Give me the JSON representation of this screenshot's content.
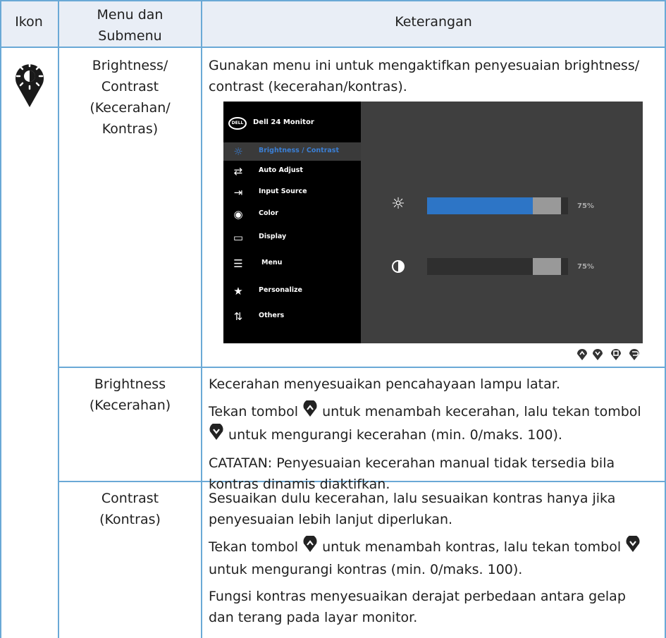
{
  "headers": {
    "icon": "Ikon",
    "menu_line1": "Menu dan",
    "menu_line2": "Submenu",
    "desc": "Keterangan"
  },
  "row1": {
    "icon_name": "brightness-icon",
    "menu": [
      "Brightness/",
      "Contrast",
      "(Kecerahan/",
      "Kontras)"
    ],
    "desc": [
      "Gunakan menu ini untuk mengaktifkan penyesuaian brightness/",
      "contrast (kecerahan/kontras)."
    ]
  },
  "osd": {
    "brand": "DELL",
    "title": "Dell 24 Monitor",
    "items": [
      {
        "label": "Brightness / Contrast",
        "icon": "sun-icon",
        "glyph": "☼",
        "selected": true
      },
      {
        "label": "Auto Adjust",
        "icon": "auto-adjust-icon",
        "glyph": "⇄",
        "selected": false
      },
      {
        "label": "Input Source",
        "icon": "input-source-icon",
        "glyph": "⇥",
        "selected": false
      },
      {
        "label": "Color",
        "icon": "color-palette-icon",
        "glyph": "◉",
        "selected": false
      },
      {
        "label": "Display",
        "icon": "display-icon",
        "glyph": "▭",
        "selected": false
      },
      {
        "label": "Menu",
        "icon": "menu-icon",
        "glyph": "☰",
        "selected": false
      },
      {
        "label": "Personalize",
        "icon": "star-icon",
        "glyph": "★",
        "selected": false
      },
      {
        "label": "Others",
        "icon": "others-icon",
        "glyph": "⇅",
        "selected": false
      }
    ],
    "brightness": {
      "level": 0.75,
      "label": "75%"
    },
    "contrast": {
      "level": 0.75,
      "label": "75%"
    }
  },
  "row2": {
    "menu": [
      "Brightness",
      "(Kecerahan)"
    ],
    "p1": "Kecerahan menyesuaikan pencahayaan lampu latar.",
    "p2a": "Tekan tombol",
    "p2b": "untuk menambah kecerahan, lalu tekan tombol",
    "p2c": "untuk mengurangi kecerahan (min. 0/maks. 100).",
    "note_label": "CATATAN:",
    "note_a": "Penyesuaian kecerahan manual tidak tersedia bila",
    "note_b": "kontras dinamis diaktifkan."
  },
  "row3": {
    "menu": [
      "Contrast",
      "(Kontras)"
    ],
    "p1a": "Sesuaikan dulu kecerahan, lalu sesuaikan kontras hanya jika",
    "p1b": "penyesuaian lebih lanjut diperlukan.",
    "p2a": "Tekan tombol",
    "p2b": "untuk menambah kontras, lalu tekan tombol",
    "p2c": "untuk mengurangi kontras (min. 0/maks. 100).",
    "p3a": "Fungsi kontras menyesuaikan derajat perbedaan antara gelap",
    "p3b": "dan terang pada layar monitor."
  },
  "colors": {
    "rule": "#6aa9d6",
    "header_bg": "#e9eef6",
    "osd_accent": "#2d75c6"
  }
}
